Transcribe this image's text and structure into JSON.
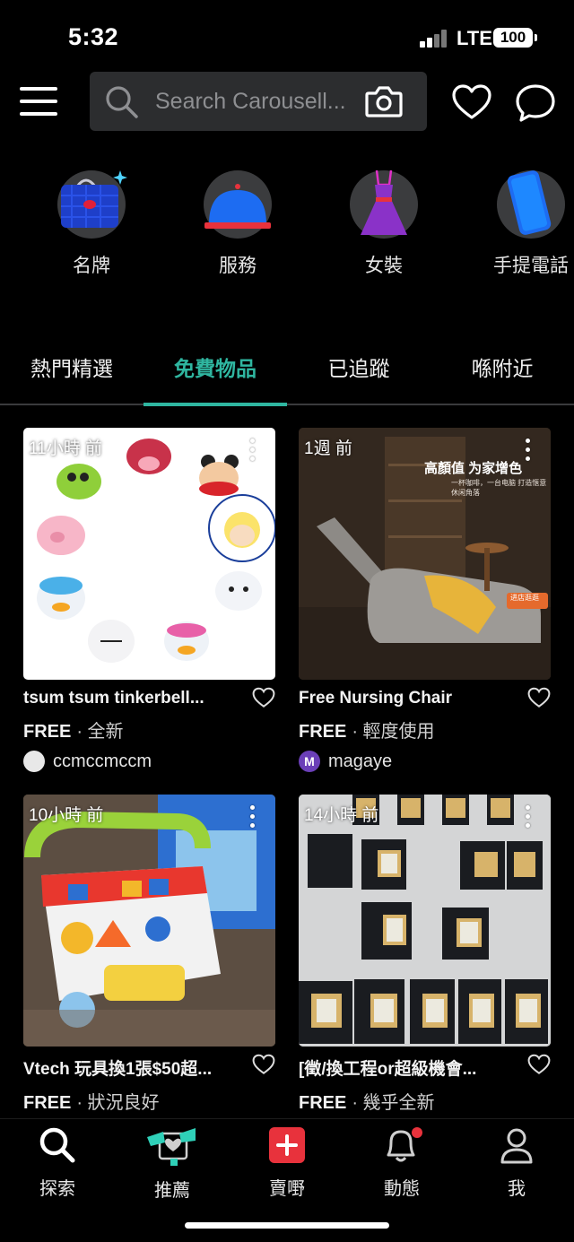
{
  "status_bar": {
    "time": "5:32",
    "network": "LTE",
    "battery": "100"
  },
  "header": {
    "search_placeholder": "Search Carousell..."
  },
  "categories": [
    {
      "label": "名牌",
      "icon": "designer-bag-icon"
    },
    {
      "label": "服務",
      "icon": "service-bell-icon"
    },
    {
      "label": "女裝",
      "icon": "dress-icon"
    },
    {
      "label": "手提電話",
      "icon": "mobile-phone-icon"
    }
  ],
  "tabs": [
    {
      "label": "熱門精選",
      "active": false
    },
    {
      "label": "免費物品",
      "active": true
    },
    {
      "label": "已追蹤",
      "active": false
    },
    {
      "label": "喺附近",
      "active": false
    }
  ],
  "listings": [
    {
      "age": "11小時 前",
      "title": "tsum tsum tinkerbell...",
      "price": "FREE",
      "condition": "· 全新",
      "seller": "ccmccmccm",
      "avatar": ""
    },
    {
      "age": "1週 前",
      "title": "Free Nursing Chair",
      "price": "FREE",
      "condition": "· 輕度使用",
      "seller": "magaye",
      "avatar": "M"
    },
    {
      "age": "10小時 前",
      "title": "Vtech 玩具換1張$50超...",
      "price": "FREE",
      "condition": "· 狀況良好",
      "seller": "",
      "avatar": ""
    },
    {
      "age": "14小時 前",
      "title": "[徵/換工程or超級機會...",
      "price": "FREE",
      "condition": "· 幾乎全新",
      "seller": "",
      "avatar": ""
    }
  ],
  "image_text": {
    "chair_banner": "高顏值 为家增色",
    "chair_sub": "一杯咖啡，一台电脑 打造惬意休闲角落",
    "chair_badge": "进店逛逛"
  },
  "bottom_nav": [
    {
      "label": "探索",
      "icon": "search-icon"
    },
    {
      "label": "推薦",
      "icon": "recommend-icon"
    },
    {
      "label": "賣嘢",
      "icon": "sell-plus-icon"
    },
    {
      "label": "動態",
      "icon": "bell-icon"
    },
    {
      "label": "我",
      "icon": "profile-icon"
    }
  ],
  "colors": {
    "accent": "#2fb6a0",
    "sell": "#e8323c",
    "background": "#000000",
    "notification": "#e8323c"
  }
}
